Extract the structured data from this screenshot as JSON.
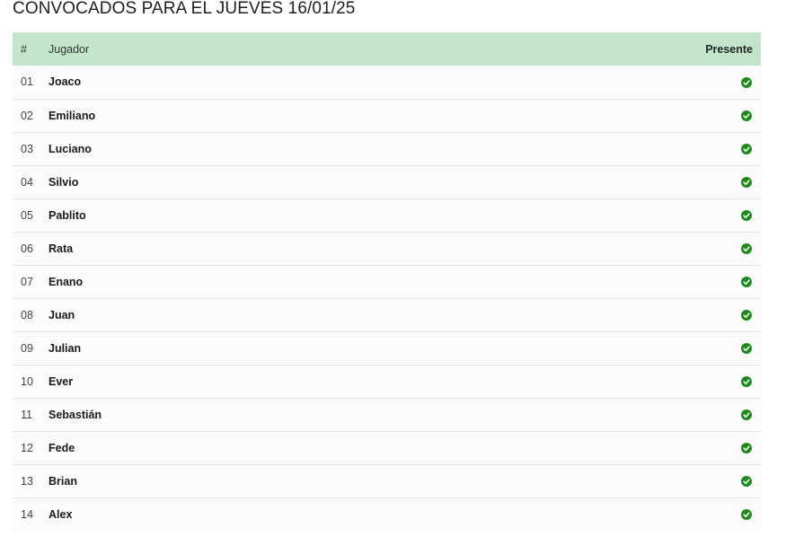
{
  "title": "CONVOCADOS PARA EL JUEVES 16/01/25",
  "table": {
    "headers": {
      "num": "#",
      "player": "Jugador",
      "present": "Presente"
    },
    "rows": [
      {
        "num": "01",
        "name": "Joaco",
        "present": true
      },
      {
        "num": "02",
        "name": "Emiliano",
        "present": true
      },
      {
        "num": "03",
        "name": "Luciano",
        "present": true
      },
      {
        "num": "04",
        "name": "Silvio",
        "present": true
      },
      {
        "num": "05",
        "name": "Pablito",
        "present": true
      },
      {
        "num": "06",
        "name": "Rata",
        "present": true
      },
      {
        "num": "07",
        "name": "Enano",
        "present": true
      },
      {
        "num": "08",
        "name": "Juan",
        "present": true
      },
      {
        "num": "09",
        "name": "Julian",
        "present": true
      },
      {
        "num": "10",
        "name": "Ever",
        "present": true
      },
      {
        "num": "11",
        "name": "Sebastián",
        "present": true
      },
      {
        "num": "12",
        "name": "Fede",
        "present": true
      },
      {
        "num": "13",
        "name": "Brian",
        "present": true
      },
      {
        "num": "14",
        "name": "Alex",
        "present": true
      }
    ],
    "icons": {
      "present": "check-circle-icon"
    },
    "colors": {
      "header_bg": "#c3e6cb",
      "check": "#1e8a1e"
    }
  }
}
